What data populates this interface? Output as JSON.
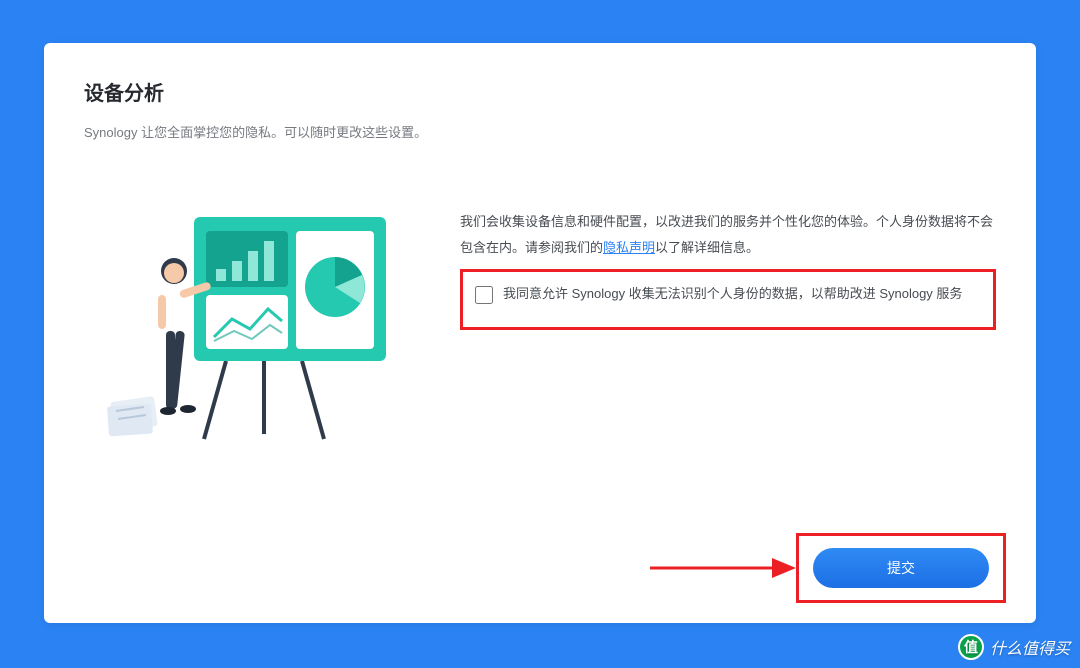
{
  "header": {
    "title": "设备分析",
    "subtitle": "Synology 让您全面掌控您的隐私。可以随时更改这些设置。"
  },
  "body": {
    "description_before_link": "我们会收集设备信息和硬件配置，以改进我们的服务并个性化您的体验。个人身份数据将不会包含在内。请参阅我们的",
    "privacy_link_text": "隐私声明",
    "description_after_link": "以了解详细信息。",
    "consent_label": "我同意允许 Synology 收集无法识别个人身份的数据，以帮助改进 Synology 服务"
  },
  "footer": {
    "submit_label": "提交"
  },
  "watermark": {
    "badge": "值",
    "text": "什么值得买"
  },
  "colors": {
    "bg": "#2b83f3",
    "highlight": "#ec2024",
    "button": "#1d6fe4"
  }
}
